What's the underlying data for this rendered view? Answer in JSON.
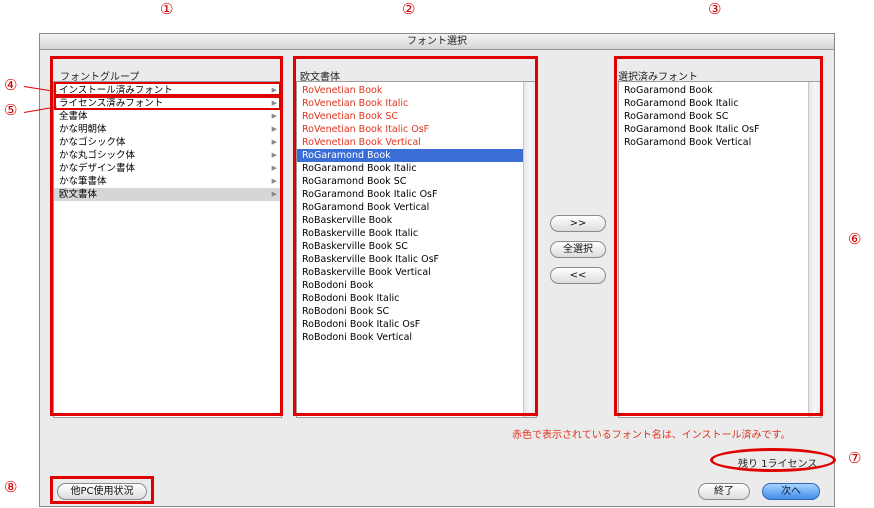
{
  "callouts": [
    "①",
    "②",
    "③",
    "④",
    "⑤",
    "⑥",
    "⑦",
    "⑧"
  ],
  "window": {
    "title": "フォント選択"
  },
  "group_list": {
    "label": "フォントグループ",
    "items": [
      {
        "label": "インストール済みフォント"
      },
      {
        "label": "ライセンス済みフォント"
      },
      {
        "label": "全書体"
      },
      {
        "label": "かな明朝体"
      },
      {
        "label": "かなゴシック体"
      },
      {
        "label": "かな丸ゴシック体"
      },
      {
        "label": "かなデザイン書体"
      },
      {
        "label": "かな筆書体"
      },
      {
        "label": "欧文書体",
        "selected": true
      }
    ]
  },
  "font_list": {
    "label": "欧文書体",
    "items": [
      {
        "label": "RoVenetian Book",
        "installed": true
      },
      {
        "label": "RoVenetian Book Italic",
        "installed": true
      },
      {
        "label": "RoVenetian Book SC",
        "installed": true
      },
      {
        "label": "RoVenetian Book Italic OsF",
        "installed": true
      },
      {
        "label": "RoVenetian Book Vertical",
        "installed": true
      },
      {
        "label": "RoGaramond Book",
        "selected": true
      },
      {
        "label": "RoGaramond Book Italic"
      },
      {
        "label": "RoGaramond Book SC"
      },
      {
        "label": "RoGaramond Book Italic OsF"
      },
      {
        "label": "RoGaramond Book Vertical"
      },
      {
        "label": "RoBaskerville Book"
      },
      {
        "label": "RoBaskerville Book Italic"
      },
      {
        "label": "RoBaskerville Book SC"
      },
      {
        "label": "RoBaskerville Book Italic OsF"
      },
      {
        "label": "RoBaskerville Book Vertical"
      },
      {
        "label": "RoBodoni Book"
      },
      {
        "label": "RoBodoni Book Italic"
      },
      {
        "label": "RoBodoni Book SC"
      },
      {
        "label": "RoBodoni Book Italic OsF"
      },
      {
        "label": "RoBodoni Book Vertical"
      }
    ]
  },
  "selected_list": {
    "label": "選択済みフォント",
    "items": [
      {
        "label": "RoGaramond Book"
      },
      {
        "label": "RoGaramond Book Italic"
      },
      {
        "label": "RoGaramond Book SC"
      },
      {
        "label": "RoGaramond Book Italic OsF"
      },
      {
        "label": "RoGaramond Book Vertical"
      }
    ]
  },
  "buttons": {
    "add": ">>",
    "select_all": "全選択",
    "remove": "<<",
    "other_pc": "他PC使用状況",
    "finish": "終了",
    "next": "次へ"
  },
  "note": "赤色で表示されているフォント名は、インストール済みです。",
  "license_remaining": "残り 1ライセンス",
  "colors": {
    "installed_text": "#e0331c",
    "selection": "#3a6ed6",
    "annotation": "#e00000"
  }
}
